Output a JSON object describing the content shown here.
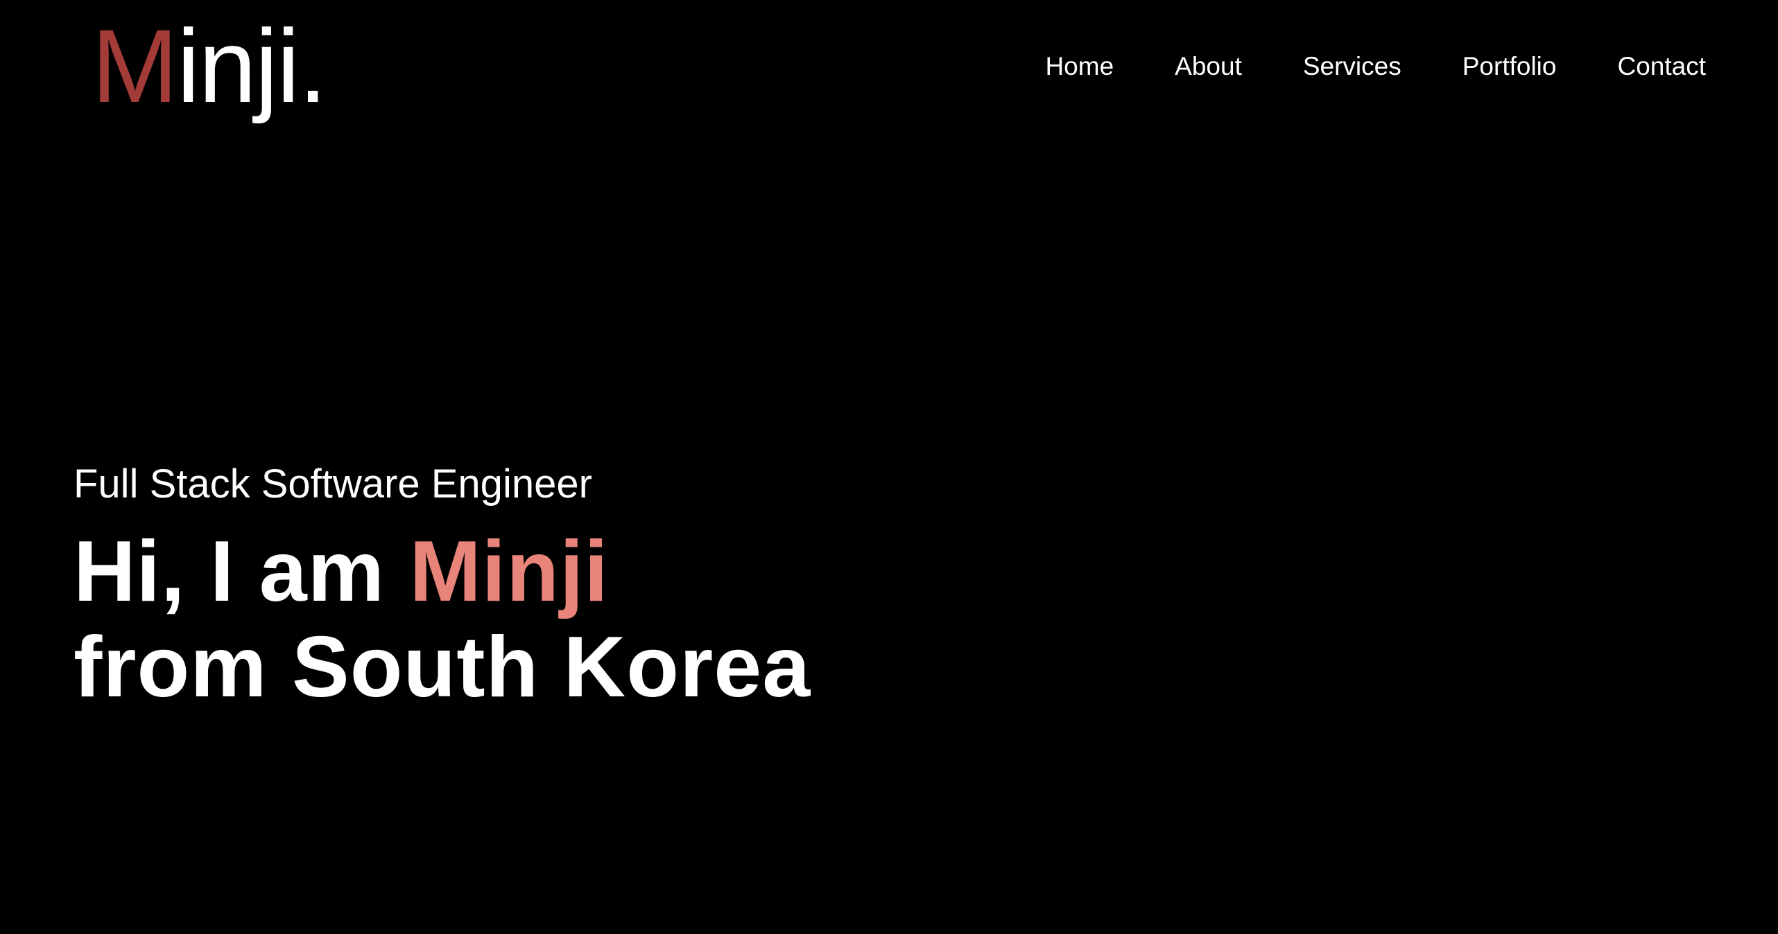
{
  "logo": {
    "accent_letter": "M",
    "rest": "inji."
  },
  "nav": {
    "items": [
      {
        "label": "Home"
      },
      {
        "label": "About"
      },
      {
        "label": "Services"
      },
      {
        "label": "Portfolio"
      },
      {
        "label": "Contact"
      }
    ]
  },
  "hero": {
    "subtitle": "Full Stack Software Engineer",
    "greeting": "Hi, I am ",
    "name": "Minji",
    "line2": "from South Korea"
  },
  "colors": {
    "background": "#000000",
    "logo_accent": "#a33c38",
    "name_highlight": "#e8847a",
    "text": "#ffffff"
  }
}
